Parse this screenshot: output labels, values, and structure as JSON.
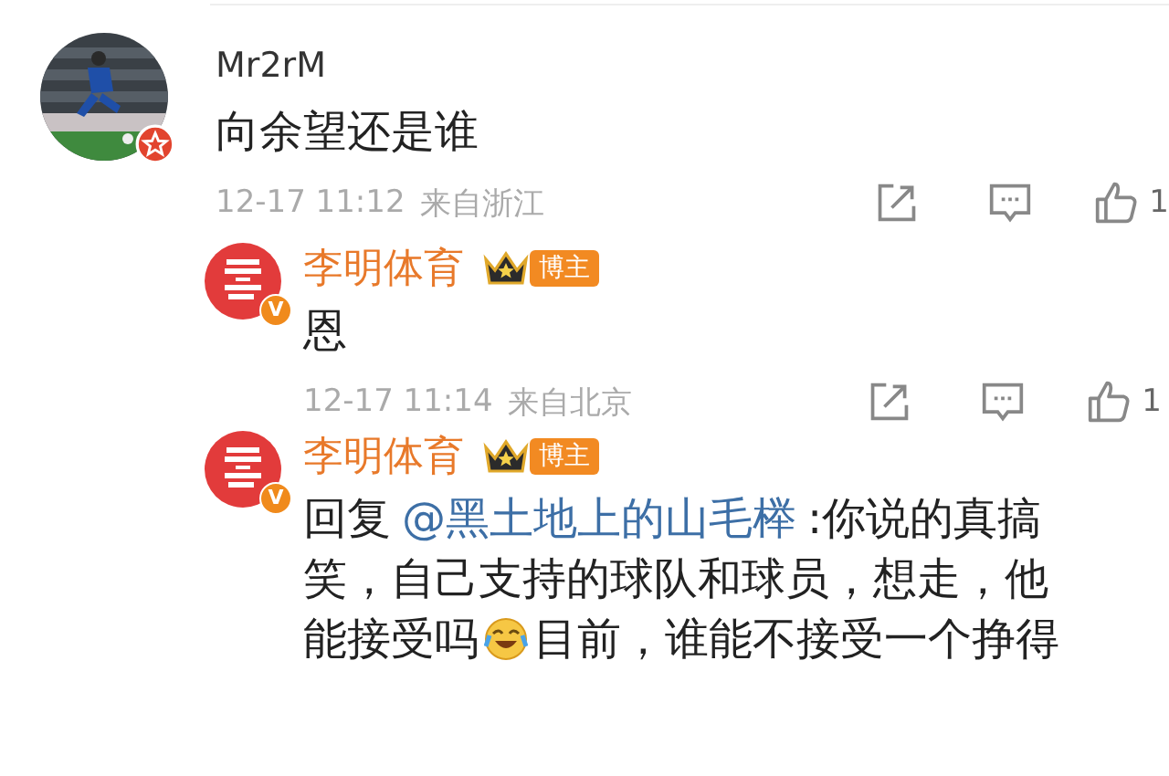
{
  "comments": [
    {
      "kind": "top",
      "avatar_badge": {
        "kind": "star"
      },
      "author": "Mr2rM",
      "body": [
        {
          "kind": "text",
          "text": "向余望还是谁"
        }
      ],
      "time": "12-17 11:12",
      "location": "来自浙江",
      "likes": "1"
    },
    {
      "kind": "reply",
      "avatar": {
        "kind": "logo"
      },
      "avatar_badge": {
        "kind": "verified",
        "text": "V"
      },
      "author": "李明体育",
      "badge": "博主",
      "body": [
        {
          "kind": "text",
          "text": "恩"
        }
      ],
      "time": "12-17 11:14",
      "location": "来自北京",
      "likes": "1"
    },
    {
      "kind": "reply",
      "avatar": {
        "kind": "logo"
      },
      "avatar_badge": {
        "kind": "verified",
        "text": "V"
      },
      "author": "李明体育",
      "badge": "博主",
      "body": [
        {
          "kind": "text",
          "text": "回复"
        },
        {
          "kind": "mention",
          "text": "@黑土地上的山毛榉"
        },
        {
          "kind": "text",
          "text": ":你说的真搞笑，自己支持的球队和球员，想走，他能接受吗"
        },
        {
          "kind": "emoji"
        },
        {
          "kind": "text",
          "text": "目前，谁能不接受一个挣得"
        }
      ]
    }
  ]
}
